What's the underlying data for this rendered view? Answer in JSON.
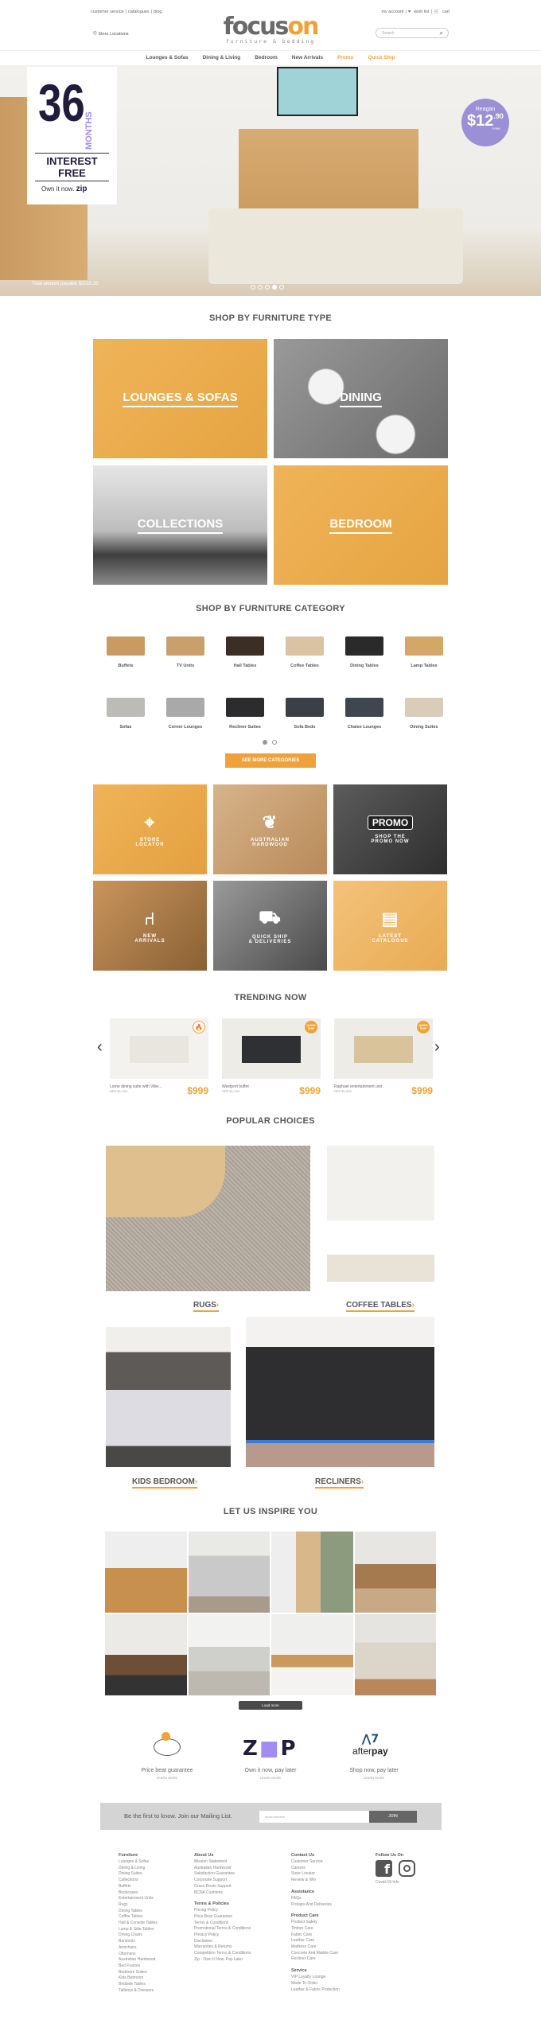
{
  "header": {
    "top_left": [
      "customer service",
      "catalogues",
      "blog"
    ],
    "top_right": {
      "account": "my account",
      "wishlist": "wish list",
      "cart": "cart"
    },
    "store_locations": "Store Locations",
    "logo": {
      "part1": "focus",
      "part2": "on",
      "tagline": "furniture & bedding"
    },
    "search_placeholder": "Search"
  },
  "nav": [
    "Lounges & Sofas",
    "Dining & Living",
    "Bedroom",
    "New Arrivals",
    "Promo",
    "Quick Ship"
  ],
  "hero": {
    "big": "36",
    "months": "MONTHS",
    "interest": "INTEREST FREE",
    "own": "Own it now.",
    "zip": "zip",
    "product": "Reagan",
    "price": "$12",
    "cents": ".90",
    "per": "P/WK",
    "fineprint": "Total amount payable $2010.20",
    "slides": 5,
    "active_slide": 4
  },
  "furniture_type": {
    "title": "SHOP BY FURNITURE TYPE",
    "tiles": [
      "LOUNGES & SOFAS",
      "DINING",
      "COLLECTIONS",
      "BEDROOM"
    ]
  },
  "furniture_category": {
    "title": "SHOP BY FURNITURE CATEGORY",
    "row1": [
      "Buffets",
      "TV Units",
      "Hall Tables",
      "Coffee Tables",
      "Dining Tables",
      "Lamp Tables"
    ],
    "row2": [
      "Sofas",
      "Corner Lounges",
      "Recliner Suites",
      "Sofa Beds",
      "Chaise Lounges",
      "Dining Suites"
    ],
    "pages": 2,
    "active_page": 1,
    "more_button": "SEE MORE CATEGORIES"
  },
  "features": [
    {
      "l1": "STORE",
      "l2": "LOCATOR",
      "icon": "map-pin-icon"
    },
    {
      "l1": "AUSTRALIAN",
      "l2": "HARDWOOD",
      "icon": "australia-icon"
    },
    {
      "promo": "PROMO",
      "l1": "SHOP THE",
      "l2": "PROMO NOW",
      "icon": "tag-icon"
    },
    {
      "l1": "NEW",
      "l2": "ARRIVALS",
      "icon": "armchair-icon"
    },
    {
      "l1": "QUICK SHIP",
      "l2": "& DELIVERIES",
      "icon": "truck-icon"
    },
    {
      "l1": "LATEST",
      "l2": "CATALOGUE",
      "icon": "book-icon"
    }
  ],
  "trending": {
    "title": "TRENDING NOW",
    "items": [
      {
        "name": "Lorne dining suite with Vibe...",
        "rrp": "RRP $1,799",
        "price": "$999"
      },
      {
        "name": "Westport buffet",
        "rrp": "RRP $1,799",
        "price": "$999",
        "badge": "QUICK SHIP"
      },
      {
        "name": "Raphael entertainment unit",
        "rrp": "RRP $1,099",
        "price": "$999",
        "badge": "QUICK SHIP"
      }
    ]
  },
  "popular": {
    "title": "POPULAR CHOICES",
    "items": [
      "RUGS",
      "COFFEE TABLES",
      "KIDS BEDROOM",
      "RECLINERS"
    ]
  },
  "inspire": {
    "title": "LET US INSPIRE YOU",
    "load_more": "Load more"
  },
  "payments": [
    {
      "title": "Price beat guarantee",
      "link": "LEARN MORE"
    },
    {
      "title": "Own it now, pay later",
      "link": "LEARN MORE"
    },
    {
      "title": "Shop now, pay later",
      "link": "LEARN MORE"
    }
  ],
  "mailing": {
    "text": "Be the first to know. Join our Mailing List.",
    "placeholder": "email address",
    "button": "JOIN"
  },
  "footer": {
    "furniture": {
      "title": "Furniture",
      "links": [
        "Lounges & Sofas",
        "Dining & Living",
        "Dining Suites",
        "Collections",
        "Buffets",
        "Bookcases",
        "Entertainment Units",
        "Rugs",
        "Dining Tables",
        "Coffee Tables",
        "Hall & Console Tables",
        "Lamp & Side Tables",
        "Dining Chairs",
        "Barstools",
        "Armchairs",
        "Ottomans",
        "Australian Hardwood",
        "Bed Frames",
        "Bedroom Suites",
        "Kids Bedroom",
        "Bedside Tables",
        "Tallboys & Dressers"
      ]
    },
    "about": {
      "title": "About Us",
      "links": [
        "Mission Statement",
        "Australian Hardwood",
        "Satisfaction Guarantee",
        "Corporate Support",
        "Grass Roots Support",
        "BCNA Cushions"
      ]
    },
    "terms": {
      "title": "Terms & Policies",
      "links": [
        "Pricing Policy",
        "Price Beat Guarantee",
        "Terms & Conditions",
        "Promotional Terms & Conditions",
        "Privacy Policy",
        "Disclaimer",
        "Warranties & Returns",
        "Competition Terms & Conditions",
        "Zip - Own It Now, Pay Later"
      ]
    },
    "contact": {
      "title": "Contact Us",
      "links": [
        "Customer Service",
        "Careers",
        "Store Locator",
        "Review & Win"
      ]
    },
    "assistance": {
      "title": "Assistance",
      "links": [
        "FAQs",
        "Pickups And Deliveries"
      ]
    },
    "care": {
      "title": "Product Care",
      "links": [
        "Product Safety",
        "Timber Care",
        "Fabric Care",
        "Leather Care",
        "Mattress Care",
        "Concrete And Marble Care",
        "Recliner Care"
      ]
    },
    "service": {
      "title": "Service",
      "links": [
        "VIP Loyalty Lounge",
        "Made To Order",
        "Leather & Fabric Protection"
      ]
    },
    "follow": {
      "title": "Follow Us On",
      "covid": "Covid-19 Info"
    }
  },
  "colors": {
    "accent": "#f0a23a",
    "zip_purple": "#a38bf4",
    "badge_purple": "#9b8fd6",
    "dark": "#4a4a4a"
  }
}
